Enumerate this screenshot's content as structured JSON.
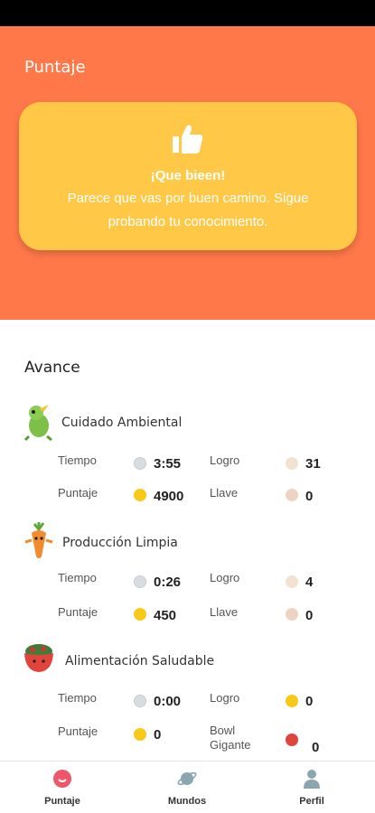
{
  "header": {
    "title": "Puntaje"
  },
  "message": {
    "title": "¡Que bieen!",
    "body": "Parece que vas por buen camino. Sigue probando tu conocimiento.",
    "icon": "thumbs-up-icon"
  },
  "avance": {
    "title": "Avance",
    "worlds": [
      {
        "name": "Cuidado Ambiental",
        "icon": "dinosaur-icon",
        "tiempo_label": "Tiempo",
        "tiempo": "3:55",
        "puntaje_label": "Puntaje",
        "puntaje": "4900",
        "logro_label": "Logro",
        "logro": "31",
        "llave_label": "Llave",
        "llave": "0"
      },
      {
        "name": "Producción Limpia",
        "icon": "carrot-icon",
        "tiempo_label": "Tiempo",
        "tiempo": "0:26",
        "puntaje_label": "Puntaje",
        "puntaje": "450",
        "logro_label": "Logro",
        "logro": "4",
        "llave_label": "Llave",
        "llave": "0"
      },
      {
        "name": "Alimentación Saludable",
        "icon": "salad-bowl-icon",
        "tiempo_label": "Tiempo",
        "tiempo": "0:00",
        "puntaje_label": "Puntaje",
        "puntaje": "0",
        "logro_label": "Logro",
        "logro": "0",
        "llave_label": "Bowl Gigante",
        "llave": "0"
      }
    ]
  },
  "nav": {
    "items": [
      {
        "label": "Puntaje",
        "icon": "puntaje-icon"
      },
      {
        "label": "Mundos",
        "icon": "planet-icon"
      },
      {
        "label": "Perfil",
        "icon": "person-icon"
      }
    ]
  },
  "colors": {
    "header": "#FF7849",
    "card": "#FFC846",
    "coin": "#F9C918",
    "nav_active": "#F0566A",
    "nav_inactive": "#8AA6AE"
  }
}
